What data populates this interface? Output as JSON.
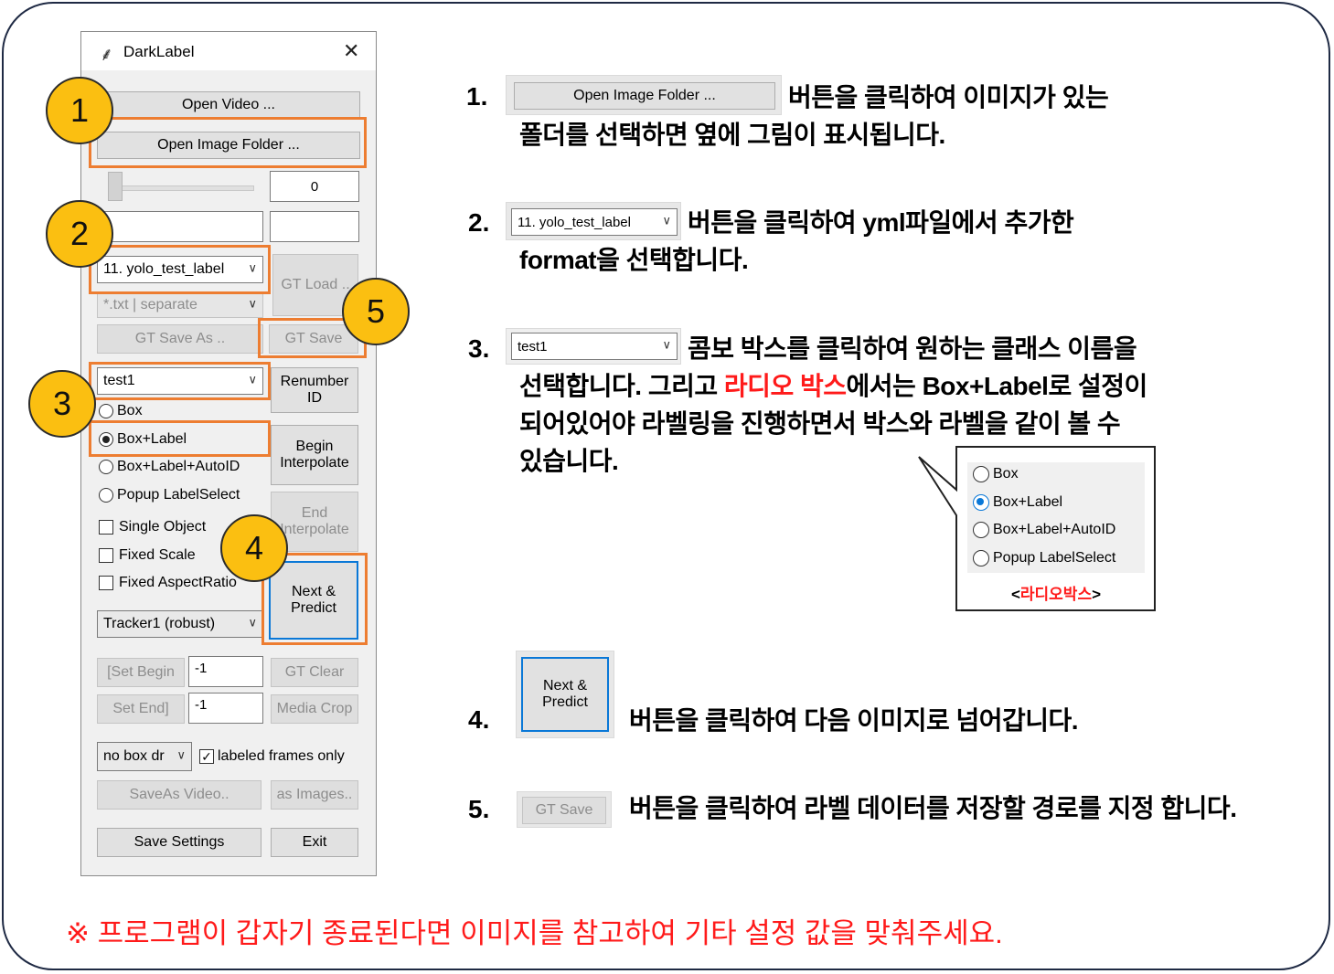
{
  "window": {
    "title": "DarkLabel",
    "open_video": "Open Video ...",
    "open_image_folder": "Open Image Folder ...",
    "frame_value": "0",
    "format_combo": "11. yolo_test_label",
    "gt_load": "GT Load ..",
    "save_format_combo": "*.txt | separate",
    "gt_save_as": "GT Save As ..",
    "gt_save": "GT Save",
    "class_combo": "test1",
    "renumber_id": "Renumber ID",
    "radios": [
      "Box",
      "Box+Label",
      "Box+Label+AutoID",
      "Popup LabelSelect"
    ],
    "radio_selected": "Box+Label",
    "begin_interpolate": "Begin Interpolate",
    "end_interpolate": "End Interpolate",
    "checkboxes": [
      "Single Object",
      "Fixed Scale",
      "Fixed AspectRatio"
    ],
    "next_predict": "Next & Predict",
    "tracker_combo": "Tracker1 (robust)",
    "set_begin": "[Set Begin",
    "set_begin_value": "-1",
    "set_end": "Set End]",
    "set_end_value": "-1",
    "gt_clear": "GT Clear",
    "media_crop": "Media Crop",
    "box_draw_combo": "no box dr",
    "labeled_frames_only": "labeled frames only",
    "save_as_video": "SaveAs Video..",
    "as_images": "as Images..",
    "save_settings": "Save Settings",
    "exit": "Exit"
  },
  "badges": [
    "1",
    "2",
    "3",
    "4",
    "5"
  ],
  "instructions": [
    {
      "number": "1.",
      "chip_label": "Open Image Folder ...",
      "line1": "버튼을 클릭하여 이미지가 있는",
      "line2": "폴더를 선택하면 옆에 그림이 표시됩니다."
    },
    {
      "number": "2.",
      "chip_label": "11. yolo_test_label",
      "line1": "버튼을 클릭하여 yml파일에서 추가한",
      "line2": "format을 선택합니다."
    },
    {
      "number": "3.",
      "chip_label": "test1",
      "line1": "콤보 박스를 클릭하여 원하는 클래스 이름을",
      "line2_a": "선택합니다. 그리고 ",
      "line2_red": "라디오 박스",
      "line2_b": "에서는 Box+Label로 설정이",
      "line3": "되어있어야 라벨링을 진행하면서 박스와 라벨을 같이 볼 수",
      "line4": "있습니다."
    },
    {
      "number": "4.",
      "chip_label": "Next & Predict",
      "line1": "버튼을 클릭하여 다음 이미지로 넘어갑니다."
    },
    {
      "number": "5.",
      "chip_label": "GT Save",
      "line1": "버튼을 클릭하여 라벨 데이터를 저장할 경로를 지정 합니다."
    }
  ],
  "callout": {
    "radios": [
      "Box",
      "Box+Label",
      "Box+Label+AutoID",
      "Popup LabelSelect"
    ],
    "caption_left": "<",
    "caption": "라디오박스",
    "caption_right": ">"
  },
  "footer_note": "※ 프로그램이 갑자기 종료된다면 이미지를 참고하여 기타 설정 값을 맞춰주세요.",
  "colors": {
    "highlight": "#ed7d31",
    "badge": "#fbbf11",
    "accent_red": "#ff1a1a",
    "focus_blue": "#0a78d7"
  }
}
